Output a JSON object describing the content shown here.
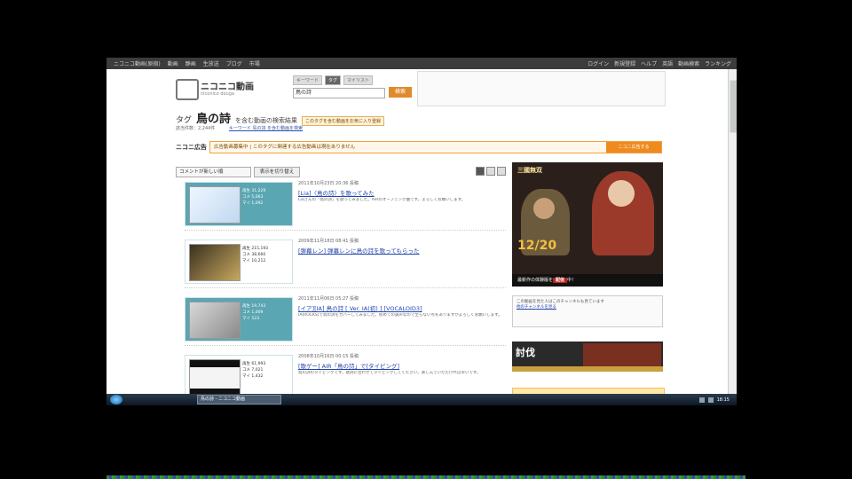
{
  "topbar": {
    "items": [
      "ニコニコ動画(原宿)",
      "動画",
      "静画",
      "生放送",
      "ブログ",
      "市場"
    ],
    "right_items": [
      "ログイン",
      "新規登録",
      "ヘルプ",
      "英語",
      "動画検索",
      "ランキング"
    ]
  },
  "logo": {
    "title": "ニコニコ動画",
    "subtitle": "niconico douga"
  },
  "search": {
    "tabs": [
      "キーワード",
      "タグ",
      "マイリスト"
    ],
    "active_tab": "タグ",
    "value": "鳥の詩",
    "button_label": "検索"
  },
  "heading": {
    "prefix": "タグ",
    "tag_name": "鳥の詩",
    "suffix": "を含む動画の検索結果",
    "badge": "このタグを含む動画をお気に入り登録"
  },
  "meta": {
    "count_text": "該当件数：2,244件",
    "link_text": "キーワード 鳥の詩 を含む動画を検索"
  },
  "nico_ad": {
    "logo": "ニコニ広告",
    "text": "広告動画募集中 | このタグに関連する広告動画は現在ありません",
    "button": "ニコニ広告する"
  },
  "sort": {
    "selected": "コメントが新しい順",
    "button": "表示を切り替え"
  },
  "videos": [
    {
      "date": "2011年10月23日 20:36 投稿",
      "title": "[Lia]〈鳥の詩〉を歌ってみた",
      "desc": "Liaさんの「鳥の詩」を歌ってみました。AIRのオープニング曲です。よろしくお願いします。",
      "stats": [
        "再生 31,229",
        "コメ 5,063",
        "マイ 1,092"
      ]
    },
    {
      "date": "2009年11月18日 08:41 投稿",
      "title": "[弾幕レン] 弾幕レンに鳥の詩を歌ってもらった",
      "desc": "",
      "stats": [
        "再生 215,193",
        "コメ 38,660",
        "マイ 10,212"
      ]
    },
    {
      "date": "2011年11月06日 05:27 投稿",
      "title": "[イア][IA] 鳥の詩 [ Ver. IA(初) ] [VOCALOID3]",
      "desc": "IA(ROCKS)で鳥の詩をカバーしてみました。初めての調声なので至らない点もありますがよろしくお願いします。",
      "stats": [
        "再生 19,743",
        "コメ 1,009",
        "マイ 523"
      ]
    },
    {
      "date": "2008年10月16日 00:15 投稿",
      "title": "[歌ゲー] AIR「鳥の詩」で[タイピング]",
      "desc": "鳥の詩のタイピングです。歌詞に合わせてタイピングしてください。楽しんでいただければ幸いです。",
      "stats": [
        "再生 61,993",
        "コメ 7,021",
        "マイ 1,432"
      ]
    }
  ],
  "side_banner": {
    "headline": "三國無双",
    "number": "12/20",
    "bottom_prefix": "最新作の体験版を",
    "bottom_highlight": "配信",
    "bottom_suffix": "中！"
  },
  "side_box": {
    "text": "この動画を見た人はこのチャンネルも見ています",
    "link": "他のチャンネルを見る"
  },
  "side_banner2": {
    "text": "討伐"
  },
  "taskbar": {
    "task": "鳥の詩 - ニコニコ動画",
    "clock": "18:15"
  }
}
